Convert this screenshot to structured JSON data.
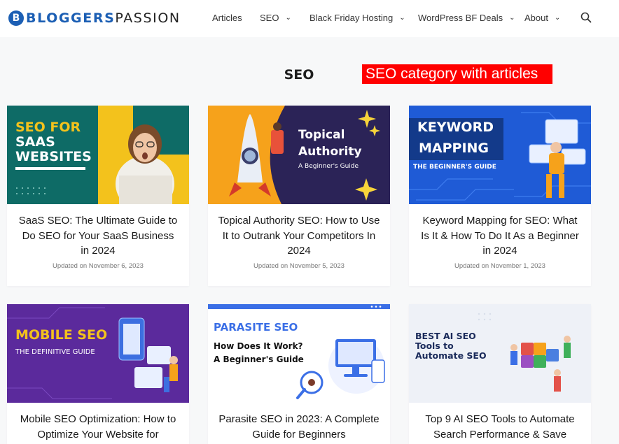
{
  "header": {
    "logo_b": "B",
    "logo_bloggers": "BLOGGERS",
    "logo_passion": "PASSION",
    "nav": [
      {
        "label": "Articles",
        "dropdown": false
      },
      {
        "label": "SEO",
        "dropdown": true
      },
      {
        "label": "Black Friday Hosting",
        "dropdown": true
      },
      {
        "label": "WordPress BF Deals",
        "dropdown": true
      },
      {
        "label": "About",
        "dropdown": true
      }
    ],
    "search_icon": "search-icon"
  },
  "page": {
    "title": "SEO",
    "annotation": "SEO category with articles"
  },
  "cards": [
    {
      "thumb_lines": [
        "SEO FOR",
        "SAAS",
        "WEBSITES"
      ],
      "title": "SaaS SEO: The Ultimate Guide to Do SEO for Your SaaS Business in 2024",
      "date": "Updated on November 6, 2023"
    },
    {
      "thumb_lines": [
        "Topical",
        "Authority",
        "A Beginner's Guide"
      ],
      "title": "Topical Authority SEO: How to Use It to Outrank Your Competitors In 2024",
      "date": "Updated on November 5, 2023"
    },
    {
      "thumb_lines": [
        "KEYWORD",
        "MAPPING",
        "THE BEGINNER'S GUIDE"
      ],
      "title": "Keyword Mapping for SEO: What Is It & How To Do It As a Beginner in 2024",
      "date": "Updated on November 1, 2023"
    },
    {
      "thumb_lines": [
        "MOBILE SEO",
        "THE DEFINITIVE GUIDE"
      ],
      "title": "Mobile SEO Optimization: How to Optimize Your Website for",
      "date": ""
    },
    {
      "thumb_lines": [
        "PARASITE SEO",
        "How Does It Work?",
        "A Beginner's Guide"
      ],
      "title": "Parasite SEO in 2023: A Complete Guide for Beginners",
      "date": ""
    },
    {
      "thumb_lines": [
        "BEST AI SEO",
        "Tools to",
        "Automate SEO"
      ],
      "title": "Top 9 AI SEO Tools to Automate Search Performance & Save",
      "date": ""
    }
  ],
  "colors": {
    "brand_blue": "#1c5fb4",
    "annotation_red": "#ff0000",
    "saas_teal": "#0e6b66",
    "saas_yellow": "#f3c21c",
    "topical_navy": "#2b2357",
    "topical_orange": "#f6a21b",
    "keyword_blue": "#1f5bd6",
    "mobile_purple": "#5b2a9c",
    "parasite_white": "#ffffff",
    "ai_light": "#eef1f7"
  }
}
